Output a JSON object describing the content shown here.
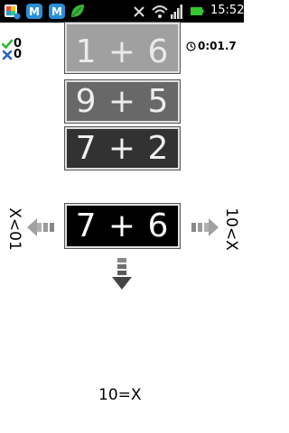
{
  "status_bar": {
    "time": "15:52",
    "icons": [
      "app-notification-icon",
      "m-icon",
      "m-icon",
      "leaf-icon",
      "close-icon",
      "wifi-icon",
      "signal-icon",
      "battery-icon"
    ],
    "colors": {
      "background": "#000000",
      "battery": "#32c832",
      "m_badge": "#2b8fd6",
      "leaf": "#3cb43c"
    }
  },
  "score": {
    "correct": "0",
    "wrong": "0"
  },
  "timer": {
    "value": "0:01.7"
  },
  "cards": {
    "top": "1 + 6",
    "middle": "9 + 5",
    "lower": "7 + 2",
    "current": "7 + 6"
  },
  "rules": {
    "left": "X<01",
    "right": "10<X",
    "bottom": "10=X"
  },
  "colors": {
    "correct": "#2db82d",
    "wrong": "#2a63c9",
    "arrow": "#8a8a8a",
    "arrow_down": "#555555"
  }
}
